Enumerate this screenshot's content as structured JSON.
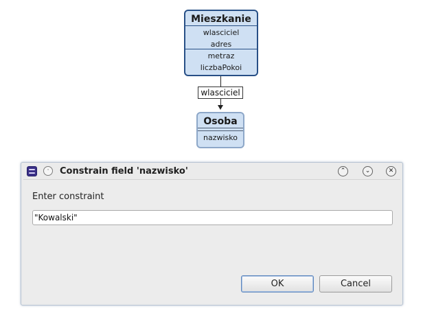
{
  "diagram": {
    "classes": [
      {
        "name": "Mieszkanie",
        "section_a": [
          "wlasciciel",
          "adres"
        ],
        "section_b": [
          "metraz",
          "liczbaPokoi"
        ]
      },
      {
        "name": "Osoba",
        "attributes": [
          "nazwisko"
        ]
      }
    ],
    "association_label": "wlasciciel"
  },
  "dialog": {
    "title": "Constrain field 'nazwisko'",
    "prompt": "Enter constraint",
    "input_value": "\"Kowalski\"",
    "ok_label": "OK",
    "cancel_label": "Cancel",
    "titlebar_icons": [
      "app-icon",
      "window-menu-icon",
      "shade-icon",
      "minimize-icon",
      "close-icon"
    ]
  },
  "colors": {
    "class_fill": "#cfe0f3",
    "class_border_selected": "#274f86",
    "class_border": "#8da7c8",
    "dialog_bg": "#ececec",
    "app_icon": "#3a2f86"
  }
}
